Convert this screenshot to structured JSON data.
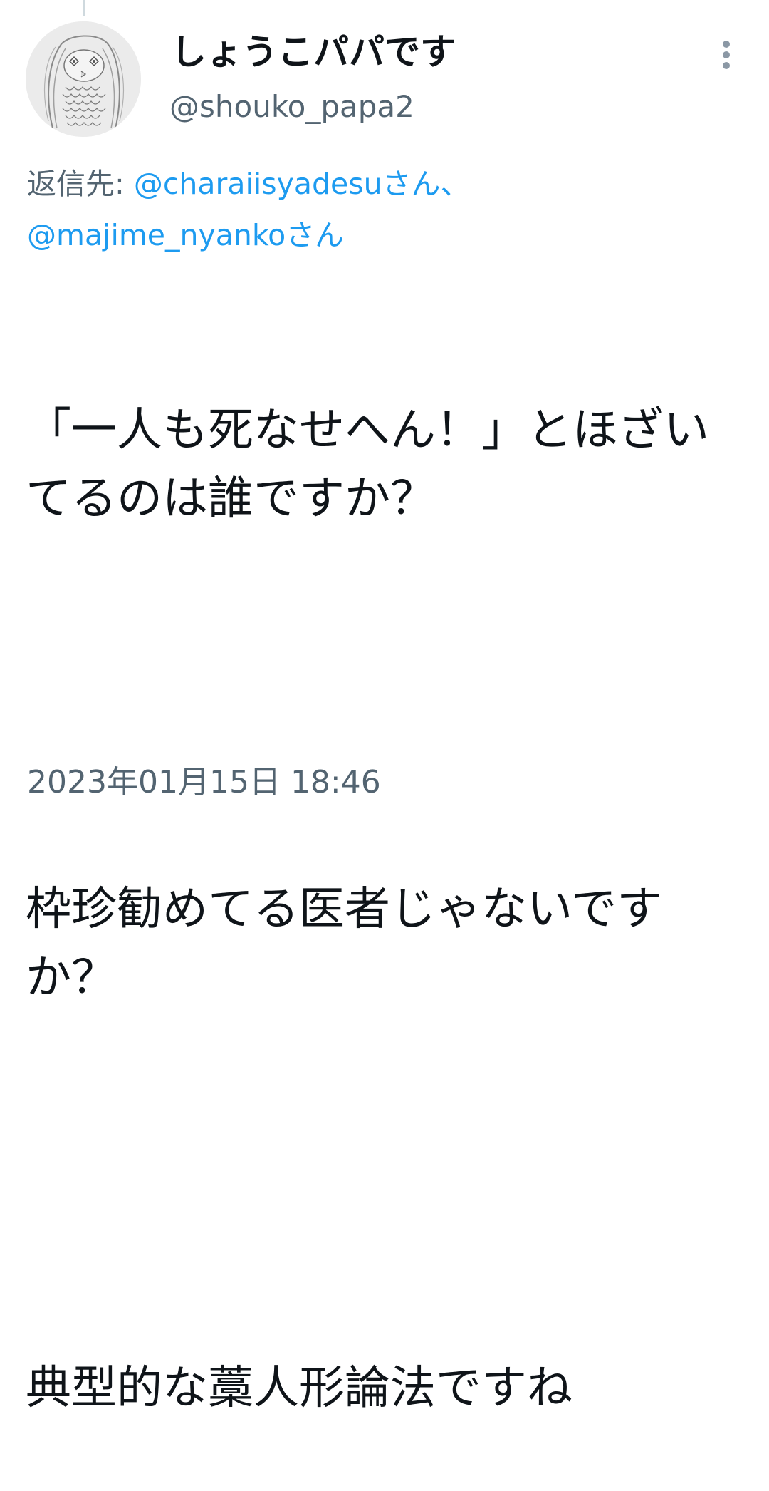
{
  "author": {
    "display_name": "しょうこパパです",
    "handle": "@shouko_papa2"
  },
  "reply_to": {
    "prefix": "返信先: ",
    "mention_1": "@charaiisyadesuさん",
    "separator": "、",
    "mention_2": "@majime_nyankoさん"
  },
  "tweet": {
    "line_1": "「一人も死なせへん！」とほざいてるのは誰ですか？",
    "line_2": "枠珍勧めてる医者じゃないですか？",
    "line_3": "典型的な藁人形論法ですね"
  },
  "timestamp": "2023年01月15日 18:46",
  "icons": {
    "avatar": "amabie-drawing-avatar",
    "menu": "more-vertical-icon"
  },
  "colors": {
    "text": "#0f1419",
    "secondary": "#536471",
    "link": "#1d9bf0",
    "thread_line": "#cfd9de"
  }
}
